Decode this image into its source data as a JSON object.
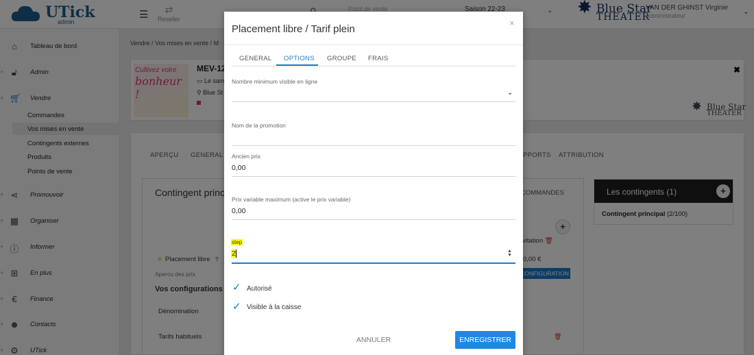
{
  "topbar": {
    "logo_text": "UTick",
    "logo_sub": "admin",
    "reseller_label": "Reseller",
    "point_de_vente": "Point de vente",
    "saison": "Saison 22-23",
    "brand_line1": "Blue Star",
    "brand_line2": "THEATER",
    "user_name": "VAN DER GHINST Virginie",
    "user_role": "Administrateur"
  },
  "sidebar": {
    "items": [
      {
        "label": "Tableau de bord",
        "icon": "home-icon"
      },
      {
        "label": "Admin",
        "icon": "lock-icon"
      },
      {
        "label": "Vendre",
        "icon": "cart-icon"
      },
      {
        "label": "Promouvoir",
        "icon": "share-icon"
      },
      {
        "label": "Organiser",
        "icon": "calendar-icon"
      },
      {
        "label": "Informer",
        "icon": "info-icon"
      },
      {
        "label": "En plus",
        "icon": "plus-square-icon"
      },
      {
        "label": "Finance",
        "icon": "euro-icon"
      },
      {
        "label": "Contacts",
        "icon": "user-icon"
      },
      {
        "label": "UTick",
        "icon": "gears-icon"
      }
    ],
    "subitems": [
      "Commandes",
      "Vos mises en vente",
      "Contingents externes",
      "Produits",
      "Points de vente"
    ]
  },
  "breadcrumb": {
    "crumb1": "Vendre",
    "crumb2": "Vos mises en vente",
    "crumb3": "M"
  },
  "event": {
    "title": "MEV-12",
    "date_line": "Le sam",
    "venue_line": "Blue St",
    "poster_line1": "Cultivez votre",
    "poster_line2": "bonheur !"
  },
  "main_tabs": {
    "apercu": "APERÇU",
    "general": "GENERAL",
    "rapports": "PPORTS",
    "attribution": "ATTRIBUTION"
  },
  "contingent": {
    "title": "Contingent princ",
    "commandes_tab": "COMMANDES",
    "invitation": "vitation",
    "placement_libre": "Placement libre",
    "help": "?",
    "price": "0,00 €",
    "apercu_prix": "Apercu des prix",
    "config_button": "CONFIGURATION",
    "vos_configurations": "Vos configurations",
    "denomination": "Dénomination",
    "tarifs_habituels": "Tarifs habituels"
  },
  "contingents_panel": {
    "title": "Les contingents (1)",
    "add": "+",
    "item_name": "Contingent principal",
    "item_count": "(2/100)"
  },
  "modal": {
    "title": "Placement libre / Tarif plein",
    "close": "×",
    "tabs": [
      "GENERAL",
      "OPTIONS",
      "GROUPE",
      "FRAIS"
    ],
    "active_tab": "OPTIONS",
    "fields": {
      "nombre_min_label": "Nombre minimum visible en ligne",
      "nombre_min_value": "",
      "nom_promo_label": "Nom de la promotion",
      "nom_promo_value": "",
      "ancien_prix_label": "Ancien prix",
      "ancien_prix_value": "0,00",
      "prix_var_label": "Prix variable maximum (active le prix variable)",
      "prix_var_value": "0,00",
      "step_label": "step",
      "step_value": "2"
    },
    "checkboxes": [
      {
        "label": "Autorisé",
        "checked": true
      },
      {
        "label": "Visible à la caisse",
        "checked": true
      }
    ],
    "cancel_label": "ANNULER",
    "save_label": "ENREGISTRER"
  },
  "colors": {
    "accent": "#1a7bcb",
    "save_button": "#1e88e5",
    "highlight": "#ffff00",
    "brand": "#1c5d8f"
  }
}
